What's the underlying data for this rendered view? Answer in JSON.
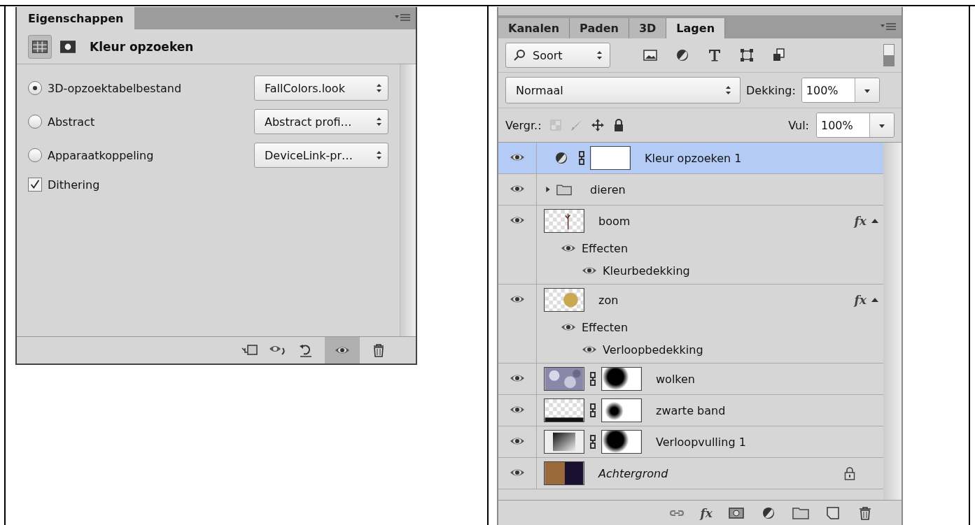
{
  "properties": {
    "tab": "Eigenschappen",
    "title": "Kleur opzoeken",
    "options": [
      {
        "kind": "radio",
        "label": "3D-opzoektabelbestand",
        "selected": true,
        "value": "FallColors.look"
      },
      {
        "kind": "radio",
        "label": "Abstract",
        "selected": false,
        "value": "Abstract profi…"
      },
      {
        "kind": "radio",
        "label": "Apparaatkoppeling",
        "selected": false,
        "value": "DeviceLink-pr…"
      },
      {
        "kind": "checkbox",
        "label": "Dithering",
        "checked": true
      }
    ]
  },
  "layers_panel": {
    "tabs": [
      {
        "label": "Kanalen",
        "selected": false
      },
      {
        "label": "Paden",
        "selected": false
      },
      {
        "label": "3D",
        "selected": false
      },
      {
        "label": "Lagen",
        "selected": true
      }
    ],
    "filter": "Soort",
    "blend_mode": "Normaal",
    "opacity_label": "Dekking:",
    "opacity": "100%",
    "lock_label": "Vergr.:",
    "fill_label": "Vul:",
    "fill": "100%",
    "layers": [
      {
        "name": "Kleur opzoeken 1",
        "kind": "adjustment",
        "selected": true,
        "mask": {
          "kind": "white"
        }
      },
      {
        "name": "dieren",
        "kind": "group",
        "selected": false
      },
      {
        "name": "boom",
        "kind": "layer",
        "thumbnail": {
          "kind": "tree"
        },
        "selected": false,
        "fx": "fx",
        "effects": {
          "label": "Effecten",
          "children": [
            "Kleurbedekking"
          ]
        }
      },
      {
        "name": "zon",
        "kind": "layer",
        "thumbnail": {
          "kind": "sun"
        },
        "selected": false,
        "fx": "fx",
        "effects": {
          "label": "Effecten",
          "children": [
            "Verloopbedekking"
          ]
        }
      },
      {
        "name": "wolken",
        "kind": "layer",
        "thumbnail": {
          "kind": "clouds"
        },
        "selected": false,
        "mask": {
          "kind": "blob"
        }
      },
      {
        "name": "zwarte band",
        "kind": "layer",
        "thumbnail": {
          "kind": "band"
        },
        "selected": false,
        "mask": {
          "kind": "dot"
        }
      },
      {
        "name": "Verloopvulling 1",
        "kind": "layer",
        "thumbnail": {
          "kind": "gradient"
        },
        "selected": false,
        "mask": {
          "kind": "blob"
        }
      },
      {
        "name": "Achtergrond",
        "kind": "background",
        "thumbnail": {
          "kind": "photo"
        },
        "selected": false,
        "locked": true
      }
    ],
    "style_button": "fx"
  }
}
